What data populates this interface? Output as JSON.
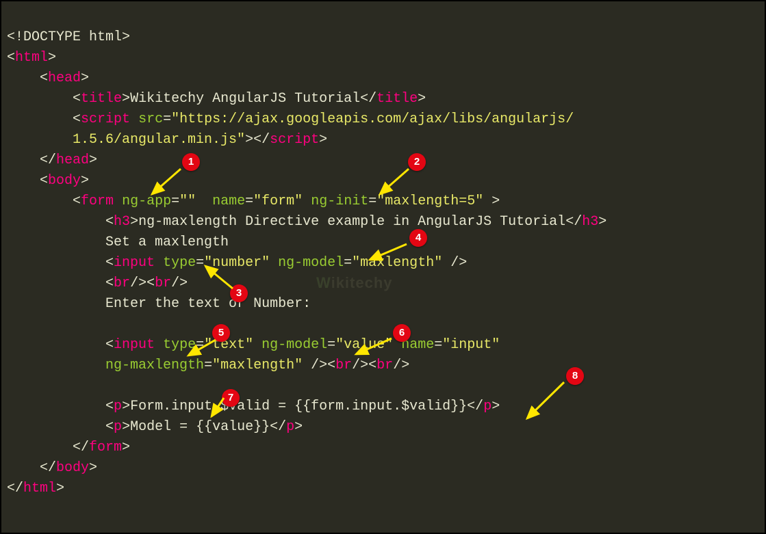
{
  "code": {
    "doctype": "<!DOCTYPE html>",
    "html_open": "html",
    "head_open": "head",
    "title_open": "title",
    "title_text": "Wikitechy AngularJS Tutorial",
    "title_close": "title",
    "script_open": "script",
    "script_src_attr": "src",
    "script_src_val": "\"https://ajax.googleapis.com/ajax/libs/angularjs/",
    "script_src_val2": "1.5.6/angular.min.js\"",
    "script_close": "script",
    "head_close": "head",
    "body_open": "body",
    "form_open": "form",
    "form_ngapp_attr": "ng-app",
    "form_ngapp_val": "\"\"",
    "form_name_attr": "name",
    "form_name_val": "\"form\"",
    "form_nginit_attr": "ng-init",
    "form_nginit_val": "\"maxlength=5\"",
    "h3_open": "h3",
    "h3_text": "ng-maxlength Directive example in AngularJS Tutorial",
    "h3_close": "h3",
    "text_setmax": "Set a maxlength",
    "input1_open": "input",
    "input1_type_attr": "type",
    "input1_type_val": "\"number\"",
    "input1_ngmodel_attr": "ng-model",
    "input1_ngmodel_val": "\"maxlength\"",
    "br": "br",
    "text_enter": "Enter the text or Number:",
    "input2_open": "input",
    "input2_type_attr": "type",
    "input2_type_val": "\"text\"",
    "input2_ngmodel_attr": "ng-model",
    "input2_ngmodel_val": "\"value\"",
    "input2_name_attr": "name",
    "input2_name_val": "\"input\"",
    "input2_ngmax_attr": "ng-maxlength",
    "input2_ngmax_val": "\"maxlength\"",
    "p_open": "p",
    "p1_text": "Form.input.$valid = {{form.input.$valid}}",
    "p2_text": "Model = {{value}}",
    "p_close": "p",
    "form_close": "form",
    "body_close": "body",
    "html_close": "html"
  },
  "badges": {
    "b1": "1",
    "b2": "2",
    "b3": "3",
    "b4": "4",
    "b5": "5",
    "b6": "6",
    "b7": "7",
    "b8": "8"
  },
  "watermark": "Wikitechy"
}
